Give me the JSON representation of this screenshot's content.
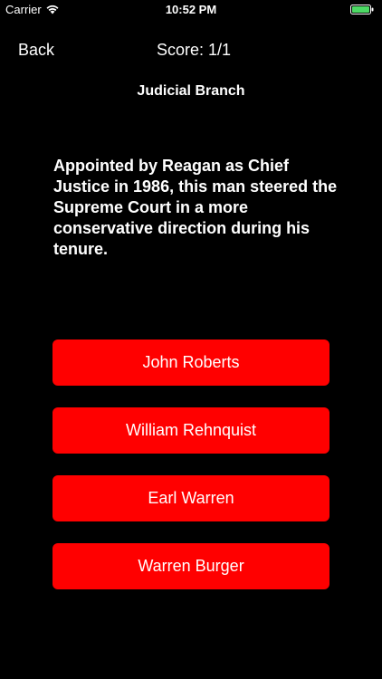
{
  "status_bar": {
    "carrier": "Carrier",
    "time": "10:52 PM",
    "battery_color": "#4cd964"
  },
  "nav": {
    "back_label": "Back",
    "score": "Score: 1/1"
  },
  "category": "Judicial Branch",
  "question": "Appointed by Reagan as Chief Justice in 1986, this man steered the Supreme Court in a more conservative direction during his tenure.",
  "answers": [
    {
      "label": "John Roberts"
    },
    {
      "label": "William Rehnquist"
    },
    {
      "label": "Earl Warren"
    },
    {
      "label": "Warren Burger"
    }
  ],
  "colors": {
    "background": "#000000",
    "button": "#ff0000",
    "text": "#ffffff"
  }
}
